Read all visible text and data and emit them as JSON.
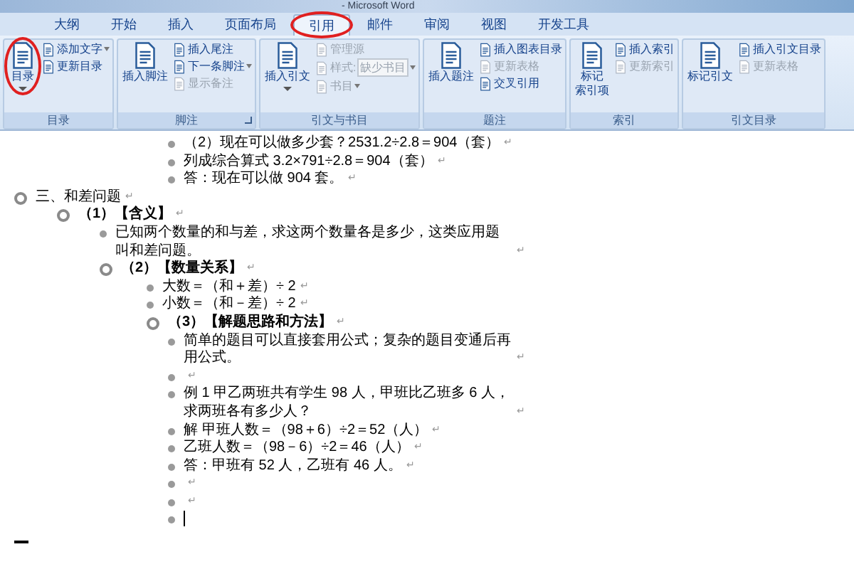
{
  "window": {
    "title": "- Microsoft Word"
  },
  "tabs": [
    {
      "label": "大纲",
      "selected": false
    },
    {
      "label": "开始",
      "selected": false
    },
    {
      "label": "插入",
      "selected": false
    },
    {
      "label": "页面布局",
      "selected": false
    },
    {
      "label": "引用",
      "selected": true,
      "annotated": true
    },
    {
      "label": "邮件",
      "selected": false
    },
    {
      "label": "审阅",
      "selected": false
    },
    {
      "label": "视图",
      "selected": false
    },
    {
      "label": "开发工具",
      "selected": false
    }
  ],
  "ribbon_groups": [
    {
      "label": "目录",
      "buttons": [
        {
          "kind": "large",
          "lines": [
            "目录"
          ],
          "disabled": false,
          "dropdown": true,
          "annotated": true
        },
        {
          "kind": "small",
          "label": "添加文字",
          "disabled": false,
          "dropdown": true
        },
        {
          "kind": "small",
          "label": "更新目录",
          "disabled": false
        }
      ]
    },
    {
      "label": "脚注",
      "launcher": true,
      "buttons": [
        {
          "kind": "large",
          "lines": [
            "插入脚注"
          ],
          "disabled": false
        },
        {
          "kind": "small",
          "label": "插入尾注",
          "disabled": false
        },
        {
          "kind": "small",
          "label": "下一条脚注",
          "disabled": false,
          "dropdown": true
        },
        {
          "kind": "small",
          "label": "显示备注",
          "disabled": true
        }
      ]
    },
    {
      "label": "引文与书目",
      "buttons": [
        {
          "kind": "large",
          "lines": [
            "插入引文"
          ],
          "disabled": false,
          "dropdown": true
        },
        {
          "kind": "small",
          "label": "管理源",
          "disabled": true
        },
        {
          "kind": "select",
          "label": "样式:",
          "value": "缺少书目",
          "disabled": true,
          "dropdown": true
        },
        {
          "kind": "small",
          "label": "书目",
          "disabled": true,
          "dropdown": true
        }
      ]
    },
    {
      "label": "题注",
      "buttons": [
        {
          "kind": "large",
          "lines": [
            "插入题注"
          ],
          "disabled": false
        },
        {
          "kind": "small",
          "label": "插入图表目录",
          "disabled": false
        },
        {
          "kind": "small",
          "label": "更新表格",
          "disabled": true
        },
        {
          "kind": "small",
          "label": "交叉引用",
          "disabled": false
        }
      ]
    },
    {
      "label": "索引",
      "buttons": [
        {
          "kind": "large",
          "lines": [
            "标记",
            "索引项"
          ],
          "disabled": false
        },
        {
          "kind": "small",
          "label": "插入索引",
          "disabled": false
        },
        {
          "kind": "small",
          "label": "更新索引",
          "disabled": true
        }
      ]
    },
    {
      "label": "引文目录",
      "buttons": [
        {
          "kind": "large",
          "lines": [
            "标记引文"
          ],
          "disabled": false
        },
        {
          "kind": "small",
          "label": "插入引文目录",
          "disabled": false
        },
        {
          "kind": "small",
          "label": "更新表格",
          "disabled": true
        }
      ]
    }
  ],
  "continued_items": [
    {
      "text": "（2）现在可以做多少套？2531.2÷2.8＝904（套）",
      "para_mark": "↵"
    },
    {
      "text": "列成综合算式 3.2×791÷2.8＝904（套）",
      "para_mark": "↵"
    },
    {
      "text": "答：现在可以做 904 套。",
      "para_mark": "↵"
    }
  ],
  "outline": [
    {
      "kind": "heading",
      "text": "三、和差问题",
      "para_mark": "↵",
      "children": [
        {
          "kind": "heading",
          "text": "（1）【含义】",
          "bold": true,
          "para_mark": "↵",
          "children": [
            {
              "kind": "body",
              "text": "已知两个数量的和与差，求这两个数量各是多少，这类应用题叫和差问题。",
              "para_mark": "↵"
            },
            {
              "kind": "heading",
              "text": "（2）【数量关系】",
              "bold": true,
              "para_mark": "↵",
              "children": [
                {
                  "kind": "body",
                  "text": "大数＝（和＋差）÷ 2",
                  "para_mark": "↵"
                },
                {
                  "kind": "body",
                  "text": "小数＝（和－差）÷ 2",
                  "para_mark": "↵"
                },
                {
                  "kind": "heading",
                  "text": "（3）【解题思路和方法】",
                  "bold": true,
                  "para_mark": "↵",
                  "children": [
                    {
                      "kind": "body",
                      "text": "简单的题目可以直接套用公式；复杂的题目变通后再用公式。",
                      "para_mark": "↵"
                    },
                    {
                      "kind": "body",
                      "para_mark": "↵"
                    },
                    {
                      "kind": "body",
                      "text": "例 1 甲乙两班共有学生 98 人，甲班比乙班多 6 人，求两班各有多少人？",
                      "para_mark": "↵"
                    },
                    {
                      "kind": "body",
                      "text": "解 甲班人数＝（98＋6）÷2＝52（人）",
                      "para_mark": "↵"
                    },
                    {
                      "kind": "body",
                      "text": "乙班人数＝（98－6）÷2＝46（人）",
                      "para_mark": "↵"
                    },
                    {
                      "kind": "body",
                      "text": "答：甲班有 52 人，乙班有 46 人。",
                      "para_mark": "↵"
                    },
                    {
                      "kind": "body",
                      "para_mark": "↵"
                    },
                    {
                      "kind": "body",
                      "para_mark": "↵"
                    },
                    {
                      "kind": "body",
                      "cursor": true
                    }
                  ]
                }
              ]
            }
          ]
        }
      ]
    }
  ]
}
